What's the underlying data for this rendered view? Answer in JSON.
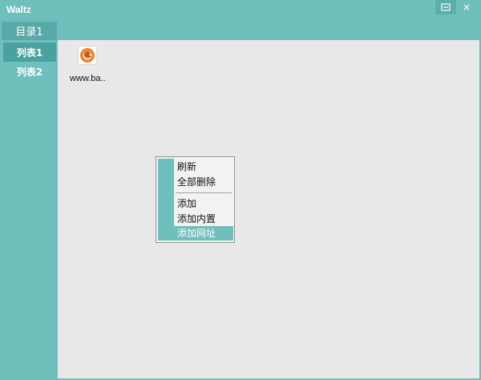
{
  "window": {
    "title": "Waltz",
    "accent_color": "#6fbfbd",
    "controls": {
      "restore_icon": "restore-icon",
      "close_label": "×"
    }
  },
  "directory_tab": {
    "label": "目录1"
  },
  "sidebar": {
    "items": [
      {
        "label": "列表1",
        "selected": true
      },
      {
        "label": "列表2",
        "selected": false
      }
    ]
  },
  "content": {
    "files": [
      {
        "name": "www.ba..",
        "icon": "browser-shortcut-icon"
      }
    ]
  },
  "context_menu": {
    "items": [
      {
        "label": "刷新"
      },
      {
        "label": "全部删除"
      },
      {
        "label": "添加"
      },
      {
        "label": "添加内置"
      },
      {
        "label": "添加网址",
        "highlighted": true
      }
    ]
  }
}
